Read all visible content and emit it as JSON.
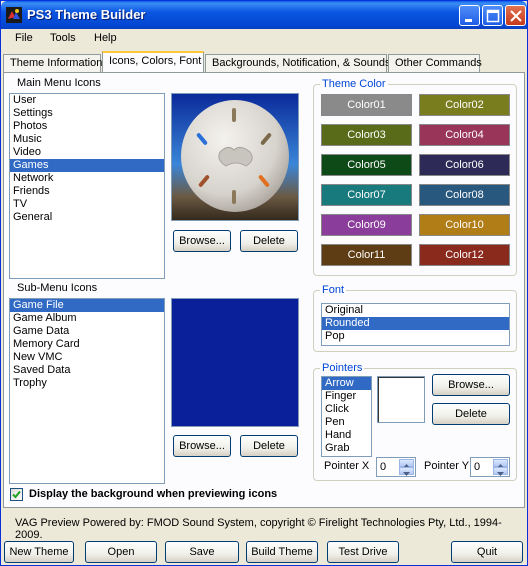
{
  "window": {
    "title": "PS3 Theme Builder"
  },
  "menu": [
    "File",
    "Tools",
    "Help"
  ],
  "tabs": [
    "Theme Information",
    "Icons, Colors, Font",
    "Backgrounds, Notification, & Sounds",
    "Other Commands"
  ],
  "main_menu": {
    "label": "Main Menu Icons",
    "items": [
      "User",
      "Settings",
      "Photos",
      "Music",
      "Video",
      "Games",
      "Network",
      "Friends",
      "TV",
      "General"
    ],
    "selected": "Games",
    "browse": "Browse...",
    "delete": "Delete"
  },
  "sub_menu": {
    "label": "Sub-Menu Icons",
    "items": [
      "Game File",
      "Game Album",
      "Game Data",
      "Memory Card",
      "New VMC",
      "Saved Data",
      "Trophy"
    ],
    "selected": "Game File",
    "browse": "Browse...",
    "delete": "Delete"
  },
  "theme_color": {
    "title": "Theme Color",
    "colors": [
      {
        "label": "Color01",
        "hex": "#8a8a8a"
      },
      {
        "label": "Color02",
        "hex": "#7a7d1e"
      },
      {
        "label": "Color03",
        "hex": "#596b19"
      },
      {
        "label": "Color04",
        "hex": "#993558"
      },
      {
        "label": "Color05",
        "hex": "#0e4a17"
      },
      {
        "label": "Color06",
        "hex": "#2d2a57"
      },
      {
        "label": "Color07",
        "hex": "#187a7d"
      },
      {
        "label": "Color08",
        "hex": "#29587e"
      },
      {
        "label": "Color09",
        "hex": "#8a3d9a"
      },
      {
        "label": "Color10",
        "hex": "#b07d16"
      },
      {
        "label": "Color11",
        "hex": "#5e3d14"
      },
      {
        "label": "Color12",
        "hex": "#8a2a1c"
      }
    ]
  },
  "font": {
    "title": "Font",
    "items": [
      "Original",
      "Rounded",
      "Pop"
    ],
    "selected": "Rounded"
  },
  "pointers": {
    "title": "Pointers",
    "items": [
      "Arrow",
      "Finger",
      "Click",
      "Pen",
      "Hand",
      "Grab"
    ],
    "selected": "Arrow",
    "browse": "Browse...",
    "delete": "Delete",
    "pointer_x_label": "Pointer X",
    "pointer_x_value": "0",
    "pointer_y_label": "Pointer Y",
    "pointer_y_value": "0"
  },
  "preview_checkbox": {
    "label": "Display the background when previewing icons",
    "checked": true
  },
  "footer": "VAG Preview Powered by: FMOD Sound System, copyright © Firelight Technologies Pty, Ltd., 1994-2009.",
  "buttons": [
    "New Theme",
    "Open",
    "Save",
    "Build Theme",
    "Test Drive",
    "Quit"
  ],
  "colors": {
    "selection": "#316ac5",
    "preview_bg": "#0a1f9a",
    "group_title": "#0046d5"
  }
}
